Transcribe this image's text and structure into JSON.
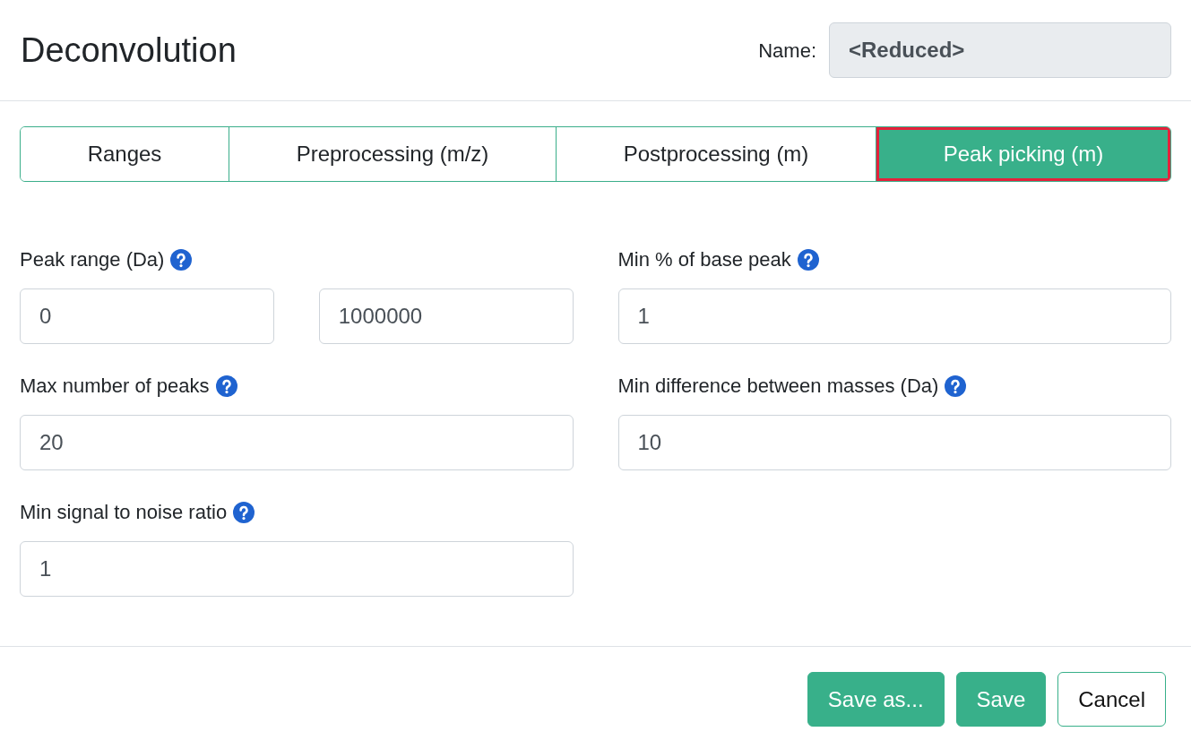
{
  "header": {
    "title": "Deconvolution",
    "name_label": "Name:",
    "name_value": "<Reduced>",
    "name_disabled": true
  },
  "tabs": [
    {
      "label": "Ranges",
      "selected": false,
      "focused": false
    },
    {
      "label": "Preprocessing (m/z)",
      "selected": false,
      "focused": false
    },
    {
      "label": "Postprocessing (m)",
      "selected": false,
      "focused": false
    },
    {
      "label": "Peak picking (m)",
      "selected": true,
      "focused": true
    }
  ],
  "fields": [
    {
      "kind": "range",
      "label": "Peak range (Da)",
      "values": [
        "0",
        "1000000"
      ]
    },
    {
      "kind": "single",
      "label": "Min % of base peak",
      "value": "1"
    },
    {
      "kind": "single",
      "label": "Max number of peaks",
      "value": "20"
    },
    {
      "kind": "single",
      "label": "Min difference between masses (Da)",
      "value": "10"
    },
    {
      "kind": "single",
      "label": "Min signal to noise ratio",
      "value": "1"
    }
  ],
  "buttons": [
    {
      "label": "Save as...",
      "kind": "primary"
    },
    {
      "label": "Save",
      "kind": "primary"
    },
    {
      "label": "Cancel",
      "kind": "outline"
    }
  ]
}
